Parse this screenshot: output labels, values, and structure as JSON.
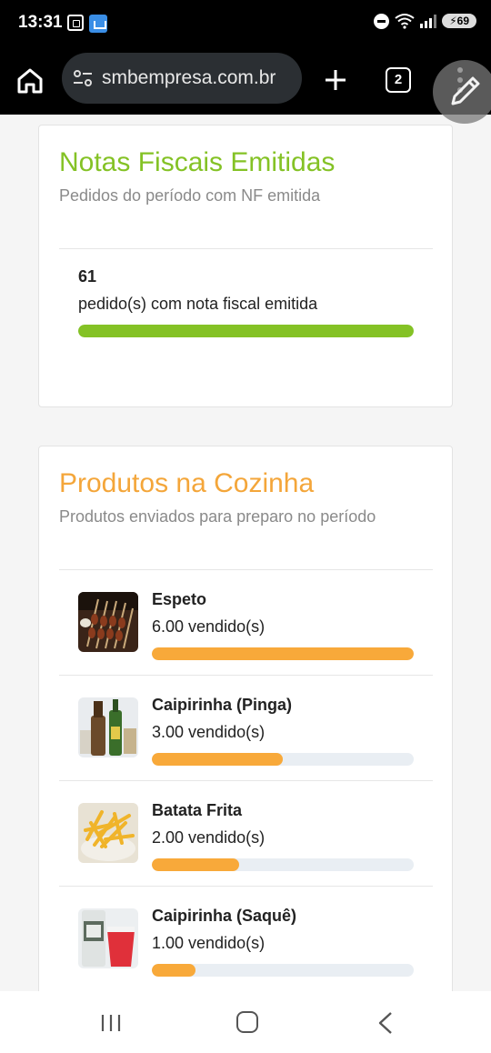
{
  "status_bar": {
    "time": "13:31",
    "battery": "69",
    "icons": [
      "screenshot-icon",
      "cloud-icon",
      "do-not-disturb-icon",
      "wifi-icon",
      "signal-icon",
      "battery-icon"
    ]
  },
  "browser": {
    "url": "smbempresa.com.br",
    "tab_count": "2",
    "icons": [
      "home-icon",
      "site-settings-icon",
      "plus-icon",
      "tabs-icon",
      "more-vert-icon",
      "edit-pencil-icon"
    ]
  },
  "nf_card": {
    "title": "Notas Fiscais Emitidas",
    "subtitle": "Pedidos do período com NF emitida",
    "count": "61",
    "count_label": "pedido(s) com nota fiscal emitida",
    "progress": 1.0,
    "color": "#84c225"
  },
  "kitchen_card": {
    "title": "Produtos na Cozinha",
    "subtitle": "Produtos enviados para preparo no período",
    "color": "#f4a63a",
    "products": [
      {
        "name": "Espeto",
        "qty": "6.00 vendido(s)",
        "progress": 1.0
      },
      {
        "name": "Caipirinha (Pinga)",
        "qty": "3.00 vendido(s)",
        "progress": 0.5
      },
      {
        "name": "Batata Frita",
        "qty": "2.00 vendido(s)",
        "progress": 0.333
      },
      {
        "name": "Caipirinha (Saquê)",
        "qty": "1.00 vendido(s)",
        "progress": 0.167
      }
    ]
  },
  "nav_bar": {
    "icons": [
      "recent-apps-icon",
      "home-icon",
      "back-icon"
    ]
  }
}
